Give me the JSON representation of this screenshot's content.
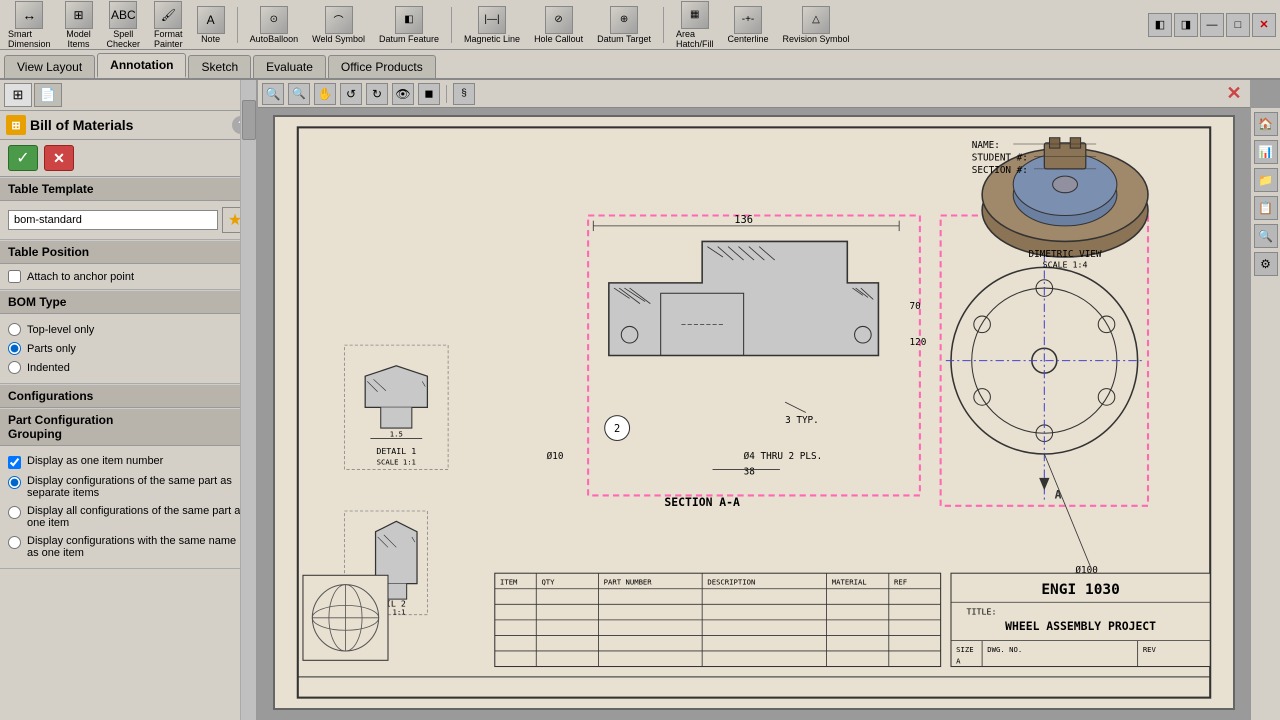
{
  "toolbar": {
    "tabs": [
      {
        "id": "view-layout",
        "label": "View Layout",
        "active": false
      },
      {
        "id": "annotation",
        "label": "Annotation",
        "active": true
      },
      {
        "id": "sketch",
        "label": "Sketch",
        "active": false
      },
      {
        "id": "evaluate",
        "label": "Evaluate",
        "active": false
      },
      {
        "id": "office-products",
        "label": "Office Products",
        "active": false
      }
    ]
  },
  "left_panel": {
    "title": "Bill of Materials",
    "help_tooltip": "?",
    "confirm_label": "✓",
    "cancel_label": "✕",
    "sections": {
      "table_template": {
        "title": "Table Template",
        "value": "bom-standard",
        "placeholder": "bom-standard"
      },
      "table_position": {
        "title": "Table Position",
        "attach_to_anchor": false,
        "attach_label": "Attach to anchor point"
      },
      "bom_type": {
        "title": "BOM Type",
        "options": [
          {
            "id": "top-level",
            "label": "Top-level only",
            "selected": false
          },
          {
            "id": "parts-only",
            "label": "Parts only",
            "selected": true
          },
          {
            "id": "indented",
            "label": "Indented",
            "selected": false
          }
        ]
      },
      "configurations": {
        "title": "Configurations",
        "collapsed": true
      },
      "part_config_grouping": {
        "title": "Part Configuration Grouping",
        "options": [
          {
            "id": "one-item-number",
            "label": "Display as one item number",
            "type": "checkbox",
            "checked": true
          },
          {
            "id": "separate-items",
            "label": "Display configurations of the same part as separate items",
            "type": "radio",
            "selected": true
          },
          {
            "id": "all-one-item",
            "label": "Display all configurations of the same part as one item",
            "type": "radio",
            "selected": false
          },
          {
            "id": "same-name",
            "label": "Display configurations with the same name as one item",
            "type": "radio",
            "selected": false
          }
        ]
      }
    }
  },
  "drawing": {
    "dimetric_view_label": "DIMETRIC VIEW",
    "dimetric_scale": "SCALE 1:4",
    "name_label": "NAME:",
    "student_label": "STUDENT #:",
    "section_label": "SECTION #:",
    "detail1_label": "DETAIL 1",
    "detail1_scale": "SCALE 1:1",
    "detail2_label": "DETAIL 2",
    "detail2_scale": "SCALE 1:1",
    "section_label2": "SECTION A-A",
    "title_block": {
      "title": "WHEEL ASSEMBLY PROJECT",
      "company": "ENGI 1030",
      "size_label": "SIZE",
      "dwg_label": "DWG. NO.",
      "rev_label": "REV"
    }
  },
  "right_sidebar": {
    "icons": [
      "🏠",
      "📊",
      "📁",
      "📋",
      "🔍",
      "⚙"
    ]
  }
}
